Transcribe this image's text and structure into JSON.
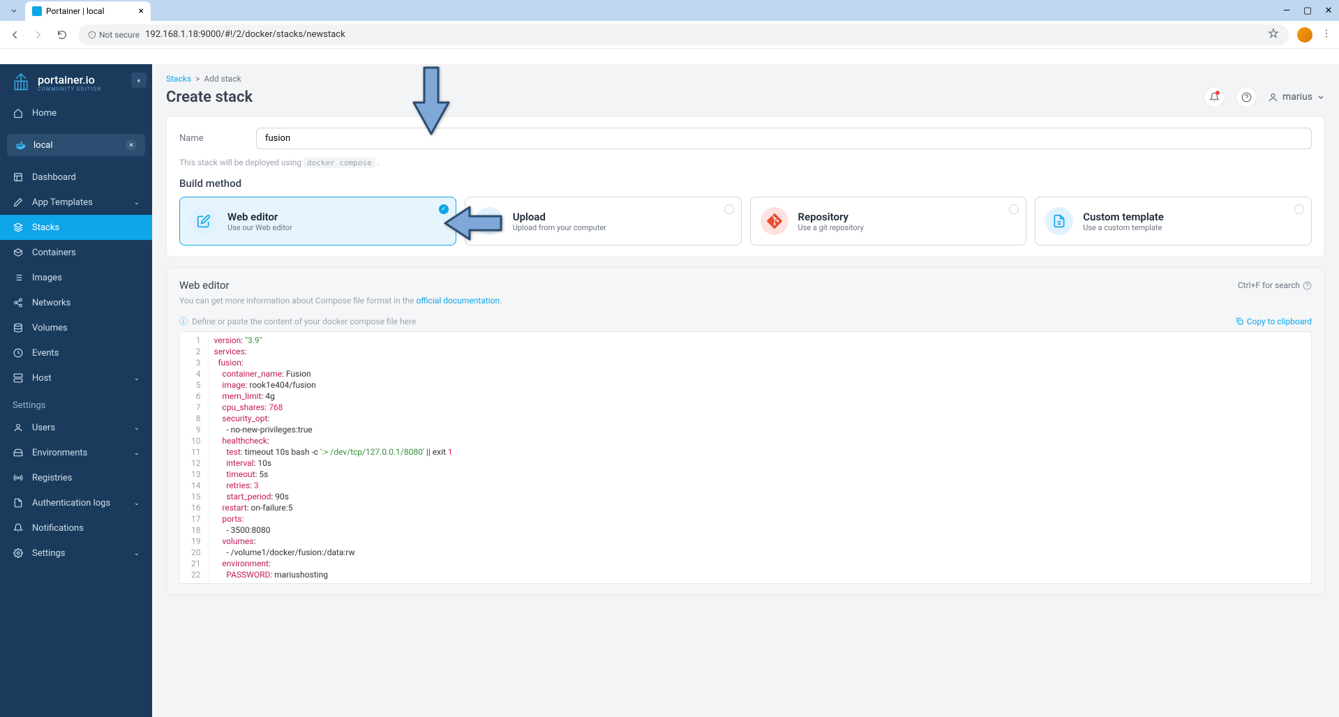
{
  "browser": {
    "tab_title": "Portainer | local",
    "security_label": "Not secure",
    "url": "192.168.1.18:9000/#!/2/docker/stacks/newstack"
  },
  "sidebar": {
    "logo": "portainer.io",
    "logo_sub": "COMMUNITY EDITION",
    "home": "Home",
    "env_name": "local",
    "items": [
      {
        "label": "Dashboard",
        "icon": "layout"
      },
      {
        "label": "App Templates",
        "icon": "edit",
        "chev": true
      },
      {
        "label": "Stacks",
        "icon": "layers",
        "active": true
      },
      {
        "label": "Containers",
        "icon": "box"
      },
      {
        "label": "Images",
        "icon": "list"
      },
      {
        "label": "Networks",
        "icon": "share"
      },
      {
        "label": "Volumes",
        "icon": "database"
      },
      {
        "label": "Events",
        "icon": "clock"
      },
      {
        "label": "Host",
        "icon": "server",
        "chev": true
      }
    ],
    "settings_label": "Settings",
    "settings": [
      {
        "label": "Users",
        "icon": "user",
        "chev": true
      },
      {
        "label": "Environments",
        "icon": "hdd",
        "chev": true
      },
      {
        "label": "Registries",
        "icon": "radio"
      },
      {
        "label": "Authentication logs",
        "icon": "file",
        "chev": true
      },
      {
        "label": "Notifications",
        "icon": "bell"
      },
      {
        "label": "Settings",
        "icon": "gear",
        "chev": true
      }
    ]
  },
  "breadcrumb": {
    "root": "Stacks",
    "current": "Add stack"
  },
  "page_title": "Create stack",
  "user": "marius",
  "form": {
    "name_label": "Name",
    "name_value": "fusion",
    "deploy_hint_pre": "This stack will be deployed using",
    "deploy_hint_code": "docker compose",
    "build_method_label": "Build method"
  },
  "methods": [
    {
      "title": "Web editor",
      "sub": "Use our Web editor",
      "selected": true,
      "icon": "edit"
    },
    {
      "title": "Upload",
      "sub": "Upload from your computer",
      "icon": "upload"
    },
    {
      "title": "Repository",
      "sub": "Use a git repository",
      "icon": "git"
    },
    {
      "title": "Custom template",
      "sub": "Use a custom template",
      "icon": "file"
    }
  ],
  "editor": {
    "title": "Web editor",
    "search_hint": "Ctrl+F for search",
    "desc_pre": "You can get more information about Compose file format in the ",
    "desc_link": "official documentation",
    "paste_hint": "Define or paste the content of your docker compose file here",
    "copy_label": "Copy to clipboard"
  },
  "code": [
    [
      {
        "t": "key",
        "v": "version"
      },
      {
        "t": "plain",
        "v": ": "
      },
      {
        "t": "str",
        "v": "\"3.9\""
      }
    ],
    [
      {
        "t": "key",
        "v": "services"
      },
      {
        "t": "plain",
        "v": ":"
      }
    ],
    [
      {
        "t": "plain",
        "v": "  "
      },
      {
        "t": "key",
        "v": "fusion"
      },
      {
        "t": "plain",
        "v": ":"
      }
    ],
    [
      {
        "t": "plain",
        "v": "    "
      },
      {
        "t": "key",
        "v": "container_name"
      },
      {
        "t": "plain",
        "v": ": Fusion"
      }
    ],
    [
      {
        "t": "plain",
        "v": "    "
      },
      {
        "t": "key",
        "v": "image"
      },
      {
        "t": "plain",
        "v": ": rook1e404/fusion"
      }
    ],
    [
      {
        "t": "plain",
        "v": "    "
      },
      {
        "t": "key",
        "v": "mem_limit"
      },
      {
        "t": "plain",
        "v": ": 4g"
      }
    ],
    [
      {
        "t": "plain",
        "v": "    "
      },
      {
        "t": "key",
        "v": "cpu_shares"
      },
      {
        "t": "plain",
        "v": ": "
      },
      {
        "t": "num",
        "v": "768"
      }
    ],
    [
      {
        "t": "plain",
        "v": "    "
      },
      {
        "t": "key",
        "v": "security_opt"
      },
      {
        "t": "plain",
        "v": ":"
      }
    ],
    [
      {
        "t": "plain",
        "v": "      - no-new-privileges:true"
      }
    ],
    [
      {
        "t": "plain",
        "v": "    "
      },
      {
        "t": "key",
        "v": "healthcheck"
      },
      {
        "t": "plain",
        "v": ":"
      }
    ],
    [
      {
        "t": "plain",
        "v": "      "
      },
      {
        "t": "key",
        "v": "test"
      },
      {
        "t": "plain",
        "v": ": timeout 10s bash -c "
      },
      {
        "t": "str",
        "v": "':> /dev/tcp/127.0.0.1/8080'"
      },
      {
        "t": "plain",
        "v": " || exit "
      },
      {
        "t": "num",
        "v": "1"
      }
    ],
    [
      {
        "t": "plain",
        "v": "      "
      },
      {
        "t": "key",
        "v": "interval"
      },
      {
        "t": "plain",
        "v": ": 10s"
      }
    ],
    [
      {
        "t": "plain",
        "v": "      "
      },
      {
        "t": "key",
        "v": "timeout"
      },
      {
        "t": "plain",
        "v": ": 5s"
      }
    ],
    [
      {
        "t": "plain",
        "v": "      "
      },
      {
        "t": "key",
        "v": "retries"
      },
      {
        "t": "plain",
        "v": ": "
      },
      {
        "t": "num",
        "v": "3"
      }
    ],
    [
      {
        "t": "plain",
        "v": "      "
      },
      {
        "t": "key",
        "v": "start_period"
      },
      {
        "t": "plain",
        "v": ": 90s"
      }
    ],
    [
      {
        "t": "plain",
        "v": "    "
      },
      {
        "t": "key",
        "v": "restart"
      },
      {
        "t": "plain",
        "v": ": on-failure:5"
      }
    ],
    [
      {
        "t": "plain",
        "v": "    "
      },
      {
        "t": "key",
        "v": "ports"
      },
      {
        "t": "plain",
        "v": ":"
      }
    ],
    [
      {
        "t": "plain",
        "v": "      - 3500:8080"
      }
    ],
    [
      {
        "t": "plain",
        "v": "    "
      },
      {
        "t": "key",
        "v": "volumes"
      },
      {
        "t": "plain",
        "v": ":"
      }
    ],
    [
      {
        "t": "plain",
        "v": "      - /volume1/docker/fusion:/data:rw"
      }
    ],
    [
      {
        "t": "plain",
        "v": "    "
      },
      {
        "t": "key",
        "v": "environment"
      },
      {
        "t": "plain",
        "v": ":"
      }
    ],
    [
      {
        "t": "plain",
        "v": "      "
      },
      {
        "t": "key",
        "v": "PASSWORD"
      },
      {
        "t": "plain",
        "v": ": mariushosting"
      }
    ]
  ]
}
